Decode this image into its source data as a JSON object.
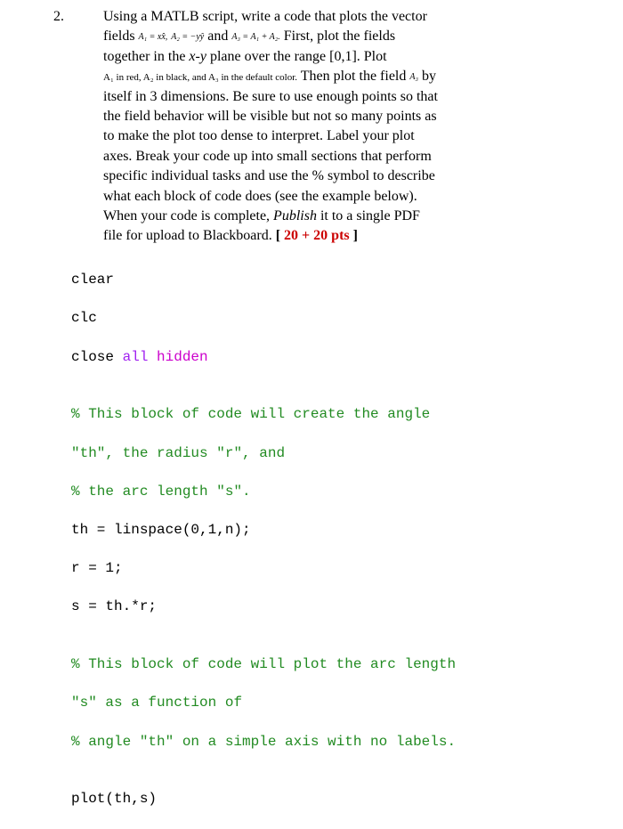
{
  "problem": {
    "number": "2.",
    "text_line1_a": "Using a MATLB script, write a code that plots the vector",
    "text_line2_a": "fields ",
    "formula_a1": "A₁ = xx̂,",
    "formula_a2": "A₂ = −yŷ",
    "text_line2_b": " and ",
    "formula_a3": "A₃ = A₁ + A₂.",
    "text_line2_c": " First, plot the fields",
    "text_line3_a": "together in the ",
    "text_line3_xy": "x-y",
    "text_line3_b": " plane over the range [0,1].   Plot",
    "small_note_a": "A₁ in red, A₂ in black, and A₃ in the default color.",
    "text_line4_b": " Then plot the field ",
    "formula_a3b": "A₃",
    "text_line4_c": " by",
    "text_line5": "itself in 3 dimensions.  Be sure to use enough points so that",
    "text_line6": "the field behavior will be visible but not so many points as",
    "text_line7": "to make the plot too dense to interpret. Label your plot",
    "text_line8": "axes.  Break your code up into small sections that perform",
    "text_line9": "specific individual tasks and use the % symbol to describe",
    "text_line10": "what each block of code does (see the example below).",
    "text_line11_a": " When your code is complete, ",
    "text_line11_publish": "Publish",
    "text_line11_b": " it to a single PDF",
    "text_line12_a": "file for upload to Blackboard.  ",
    "points_open": "[ ",
    "points_red": "20 + 20 pts",
    "points_close": " ]"
  },
  "code": {
    "l1": "clear",
    "l2": "clc",
    "l3a": "close ",
    "l3b": "all ",
    "l3c": "hidden",
    "blank1": "",
    "c1": "% This block of code will create the angle",
    "c2a": "\"th\"",
    "c2b": ", the radius ",
    "c2c": "\"r\"",
    "c2d": ", and",
    "c3a": "% the arc length ",
    "c3b": "\"s\"",
    "c3c": ".",
    "l4": "th = linspace(0,1,n);",
    "l5": "r = 1;",
    "l6": "s = th.*r;",
    "blank2": "",
    "c4": "% This block of code will plot the arc length",
    "c5a": "\"s\"",
    "c5b": " as a function of",
    "c6a": "% angle ",
    "c6b": "\"th\"",
    "c6c": " on a simple axis with no labels.",
    "blank3": "",
    "l7": "plot(th,s)"
  }
}
